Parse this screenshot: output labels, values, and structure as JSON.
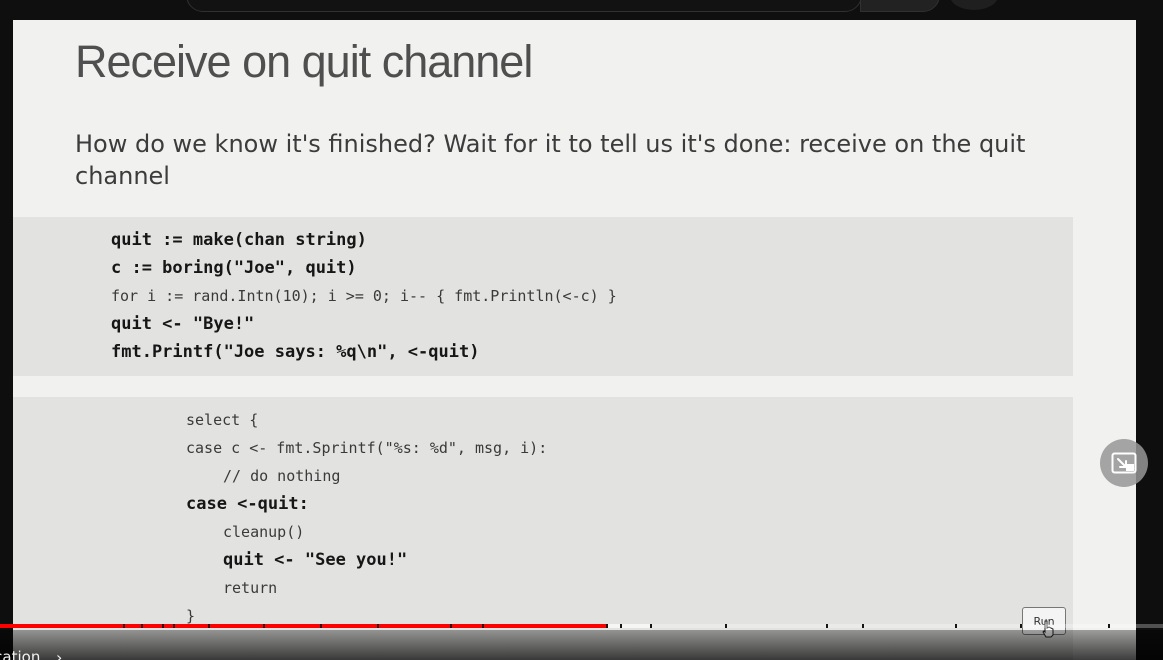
{
  "slide": {
    "title": "Receive on quit channel",
    "body": "How do we know it's finished? Wait for it to tell us it's done: receive on the quit channel",
    "code_block_1": [
      {
        "text": "quit := make(chan string)",
        "bold": true
      },
      {
        "text": "c := boring(\"Joe\", quit)",
        "bold": true
      },
      {
        "text": "for i := rand.Intn(10); i >= 0; i-- { fmt.Println(<-c) }",
        "bold": false
      },
      {
        "text": "quit <- \"Bye!\"",
        "bold": true
      },
      {
        "text": "fmt.Printf(\"Joe says: %q\\n\", <-quit)",
        "bold": true
      }
    ],
    "code_block_2": [
      {
        "text": "select {",
        "bold": false,
        "indent": 0
      },
      {
        "text": "case c <- fmt.Sprintf(\"%s: %d\", msg, i):",
        "bold": false,
        "indent": 0
      },
      {
        "text": "// do nothing",
        "bold": false,
        "indent": 1
      },
      {
        "text": "case <-quit:",
        "bold": true,
        "indent": 0
      },
      {
        "text": "cleanup()",
        "bold": false,
        "indent": 1
      },
      {
        "text": "quit <- \"See you!\"",
        "bold": true,
        "indent": 1
      },
      {
        "text": "return",
        "bold": false,
        "indent": 1
      },
      {
        "text": "}",
        "bold": false,
        "indent": 0
      }
    ],
    "run_label": "Run"
  },
  "player": {
    "chapter_title": "ication",
    "progress_fraction": 0.521,
    "buffer_fraction": 0.559,
    "miniplayer_icon": "miniplayer-icon",
    "colors": {
      "progress": "#ff0000",
      "slide_bg": "#f1f1ef",
      "code_bg": "#e2e2e0"
    }
  }
}
